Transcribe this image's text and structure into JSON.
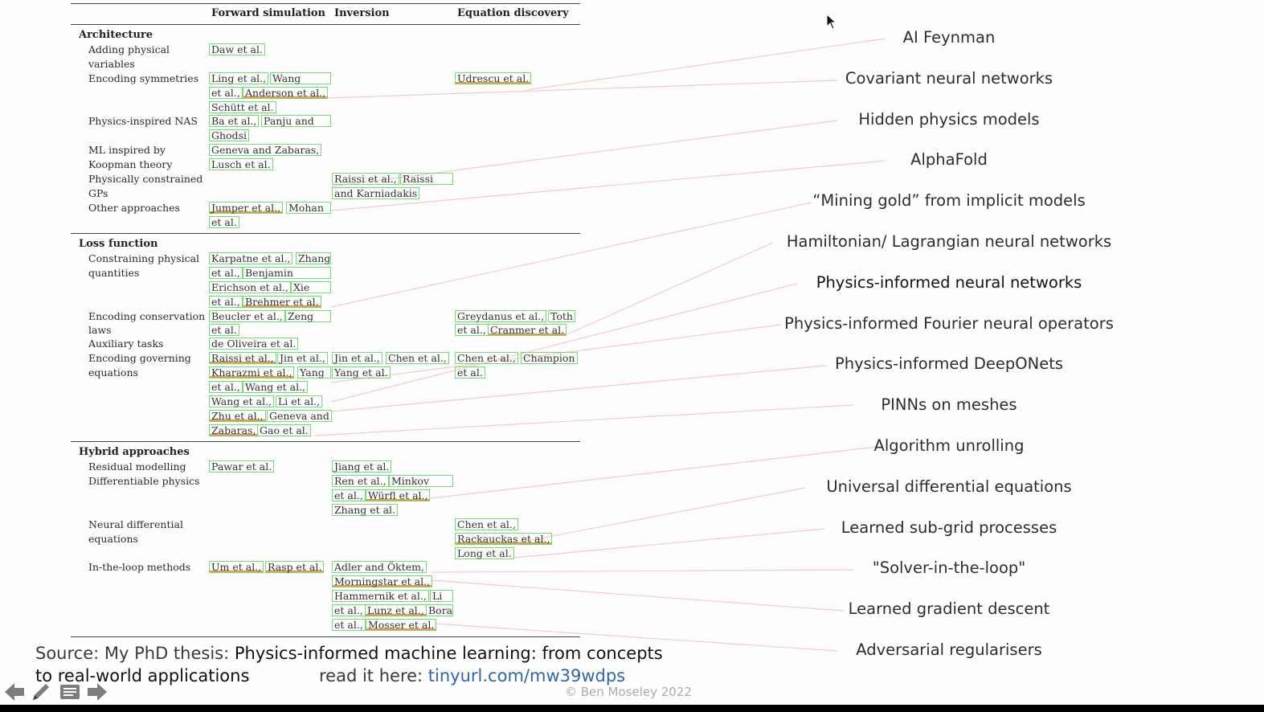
{
  "table": {
    "col_headers": [
      {
        "text": "Forward simulation"
      },
      {
        "text": "Inversion"
      },
      {
        "text": "Equation discovery"
      }
    ],
    "sections": [
      {
        "title": "Architecture",
        "rows": [
          {
            "label": [
              "Adding physical",
              "variables"
            ]
          },
          {
            "label": [
              "Encoding symmetries"
            ]
          },
          {
            "label": [
              "Physics-inspired NAS"
            ]
          },
          {
            "label": [
              "ML inspired by",
              "Koopman theory"
            ]
          },
          {
            "label": [
              "Physically constrained",
              "GPs"
            ]
          },
          {
            "label": [
              "Other approaches"
            ]
          }
        ]
      },
      {
        "title": "Loss function",
        "rows": [
          {
            "label": [
              "Constraining physical",
              "quantities"
            ]
          },
          {
            "label": [
              "Encoding conservation",
              "laws"
            ]
          },
          {
            "label": [
              "Auxiliary tasks"
            ]
          },
          {
            "label": [
              "Encoding governing",
              "equations"
            ]
          }
        ]
      },
      {
        "title": "Hybrid approaches",
        "rows": [
          {
            "label": [
              "Residual modelling"
            ]
          },
          {
            "label": [
              "Differentiable physics"
            ]
          },
          {
            "label": [
              "Neural differential",
              "equations"
            ]
          },
          {
            "label": [
              "In-the-loop methods"
            ]
          }
        ]
      }
    ],
    "citations": [
      "Daw et al.",
      "Ling et al.,",
      "Wang",
      "et al.,",
      "Anderson et al.,",
      "Schütt et al.",
      "Udrescu et al.",
      "Ba et al.,",
      "Panju and",
      "Ghodsi",
      "Geneva and Zabaras,",
      "Lusch et al.",
      "Raissi et al.,",
      "Raissi",
      "and Karniadakis",
      "Jumper et al.,",
      "Mohan",
      "et al.",
      "Karpatne et al.,",
      "Zhang",
      "et al.,",
      "Benjamin",
      "Erichson et al.,",
      "Xie",
      "et al.,",
      "Brehmer et al.",
      "Beucler et al.,",
      "Zeng",
      "et al.",
      "Greydanus et al.,",
      "Toth",
      "et al.,",
      "Cranmer et al.",
      "de Oliveira et al.",
      "Raissi et al.,",
      "Jin et al.,",
      "Jin et al.,",
      "Chen et al.,",
      "Chen et al.,",
      "Champion",
      "Kharazmi et al.,",
      "Yang",
      "Yang et al.",
      "et al.",
      "et al.,",
      "Wang et al.,",
      "Wang et al.,",
      "Li et al.,",
      "Zhu et al.,",
      "Geneva and",
      "Zabaras,",
      "Gao et al.",
      "Pawar et al.",
      "Jiang et al.",
      "Ren et al.,",
      "Minkov",
      "et al.,",
      "Würfl et al.,",
      "Zhang et al.",
      "Chen et al.,",
      "Rackauckas et al.,",
      "Long et al.",
      "Um et al.,",
      "Rasp et al.",
      "Adler and Öktem,",
      "Morningstar et al.,",
      "Hammernik et al.,",
      "Li",
      "et al.,",
      "Lunz et al.,",
      "Bora",
      "et al.,",
      "Mosser et al."
    ]
  },
  "topics": [
    "AI Feynman",
    "Covariant neural networks",
    "Hidden physics models",
    "AlphaFold",
    "“Mining gold” from implicit models",
    "Hamiltonian/ Lagrangian neural networks",
    "Physics-informed neural networks",
    "Physics-informed Fourier neural operators",
    "Physics-informed DeepONets",
    "PINNs on meshes",
    "Algorithm unrolling",
    "Universal differential equations",
    "Learned sub-grid processes",
    "\"Solver-in-the-loop\"",
    "Learned gradient descent",
    "Adversarial regularisers"
  ],
  "source": {
    "prefix": "Source: My PhD thesis: ",
    "title_line1": "Physics-informed machine learning: from concepts",
    "title_line2": "to real-world applications",
    "read_label": "read it here: ",
    "link": "tinyurl.com/mw39wdps",
    "copyright": "© Ben Moseley 2022"
  },
  "nav": {
    "icons": [
      "arrow-left-icon",
      "pen-icon",
      "slides-icon",
      "arrow-right-icon"
    ]
  },
  "colors": {
    "citation_box": "#6ee06e",
    "underline": "#e39a4c",
    "connector": "#f3c6c0",
    "link": "#2f66ad"
  }
}
